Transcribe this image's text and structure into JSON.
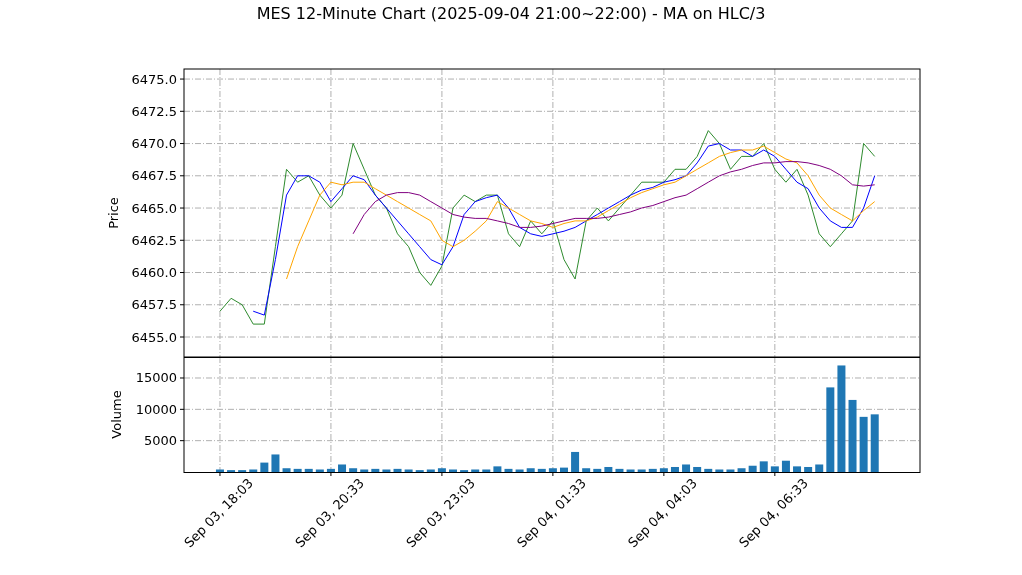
{
  "title": "MES 12-Minute Chart (2025-09-04 21:00~22:00) - MA on HLC/3",
  "price_panel": {
    "chart_data": {
      "type": "line",
      "ylabel": "Price",
      "grid": true,
      "ylim": [
        6453.45,
        6475.78
      ],
      "yticks": [
        {
          "value": 6455,
          "label": "6455.0"
        },
        {
          "value": 6457.5,
          "label": "6457.5"
        },
        {
          "value": 6460,
          "label": "6460.0"
        },
        {
          "value": 6462.5,
          "label": "6462.5"
        },
        {
          "value": 6465,
          "label": "6465.0"
        },
        {
          "value": 6467.5,
          "label": "6467.5"
        },
        {
          "value": 6470,
          "label": "6470.0"
        },
        {
          "value": 6472.5,
          "label": "6472.5"
        },
        {
          "value": 6475,
          "label": "6475.0"
        }
      ],
      "series": [
        {
          "color": "#2e8b2e",
          "values": [
            6457,
            6458,
            6457.5,
            6456,
            6456,
            6462,
            6468,
            6467,
            6467.5,
            6466,
            6465,
            6466,
            6470,
            6468,
            6466,
            6465,
            6463,
            6462,
            6460,
            6459,
            6460.5,
            6465,
            6466,
            6465.5,
            6466,
            6466,
            6463,
            6462,
            6464,
            6463,
            6464,
            6461,
            6459.5,
            6464,
            6465,
            6464,
            6465,
            6466,
            6467,
            6467,
            6467,
            6468,
            6468,
            6469,
            6471,
            6470,
            6468,
            6469,
            6469,
            6470,
            6468,
            6467,
            6468,
            6466,
            6463,
            6462,
            6463,
            6464,
            6470,
            6469
          ]
        },
        {
          "color": "#0000ff",
          "values": [
            null,
            null,
            null,
            6457,
            6456.7,
            6461,
            6466,
            6467.5,
            6467.5,
            6467,
            6465.5,
            6466.5,
            6467.5,
            6467.2,
            6466,
            6465,
            6464,
            6463,
            6462,
            6461,
            6460.6,
            6462,
            6464.5,
            6465.5,
            6465.8,
            6466,
            6465,
            6463.5,
            6463,
            6462.8,
            6463,
            6463.2,
            6463.5,
            6464,
            6464.5,
            6465,
            6465.5,
            6466,
            6466.4,
            6466.6,
            6467,
            6467.2,
            6467.5,
            6468.5,
            6469.8,
            6470,
            6469.5,
            6469.5,
            6469,
            6469.5,
            6469,
            6468,
            6467,
            6466.5,
            6465,
            6464,
            6463.5,
            6463.5,
            6465,
            6467.5
          ]
        },
        {
          "color": "#ffa500",
          "values": [
            null,
            null,
            null,
            null,
            null,
            null,
            6459.5,
            6462,
            6464,
            6466,
            6467,
            6466.8,
            6467,
            6467,
            6466.5,
            6466,
            6465.5,
            6465,
            6464.5,
            6464,
            6462.5,
            6462,
            6462.5,
            6463.2,
            6464,
            6465.5,
            6465,
            6464.5,
            6464,
            6463.8,
            6463.5,
            6463.8,
            6464,
            6464,
            6464.3,
            6464.8,
            6465.3,
            6465.8,
            6466.2,
            6466.5,
            6466.8,
            6467,
            6467.5,
            6468,
            6468.5,
            6469,
            6469.3,
            6469.5,
            6469.5,
            6469.8,
            6469.3,
            6468.8,
            6468.5,
            6467.5,
            6466,
            6465,
            6464.5,
            6464,
            6464.8,
            6465.5
          ]
        },
        {
          "color": "#800080",
          "values": [
            null,
            null,
            null,
            null,
            null,
            null,
            null,
            null,
            null,
            null,
            null,
            null,
            6463,
            6464.5,
            6465.5,
            6466,
            6466.2,
            6466.2,
            6466,
            6465.5,
            6465,
            6464.5,
            6464.3,
            6464.2,
            6464.2,
            6464,
            6463.8,
            6463.5,
            6463.5,
            6463.6,
            6463.8,
            6464,
            6464.2,
            6464.2,
            6464.2,
            6464.3,
            6464.5,
            6464.7,
            6465,
            6465.2,
            6465.5,
            6465.8,
            6466,
            6466.5,
            6467,
            6467.5,
            6467.8,
            6468,
            6468.3,
            6468.5,
            6468.5,
            6468.6,
            6468.6,
            6468.5,
            6468.3,
            6468,
            6467.5,
            6466.8,
            6466.7,
            6466.8
          ]
        }
      ]
    }
  },
  "volume_panel": {
    "chart_data": {
      "type": "bar",
      "ylabel": "Volume",
      "categories": [
        "Sep 03, 18:03",
        null,
        null,
        null,
        null,
        null,
        null,
        null,
        null,
        null,
        "Sep 03, 20:33",
        null,
        null,
        null,
        null,
        null,
        null,
        null,
        null,
        null,
        "Sep 03, 23:03",
        null,
        null,
        null,
        null,
        null,
        null,
        null,
        null,
        null,
        "Sep 04, 01:33",
        null,
        null,
        null,
        null,
        null,
        null,
        null,
        null,
        null,
        "Sep 04, 04:03",
        null,
        null,
        null,
        null,
        null,
        null,
        null,
        null,
        null,
        "Sep 04, 06:33",
        null,
        null,
        null,
        null,
        null,
        null,
        null,
        null,
        null
      ],
      "grid": true,
      "ylim": [
        0,
        18350
      ],
      "yticks": [
        {
          "value": 5000,
          "label": "5000"
        },
        {
          "value": 10000,
          "label": "10000"
        },
        {
          "value": 15000,
          "label": "15000"
        }
      ],
      "series": [
        {
          "color": "#1f77b4",
          "values": [
            400,
            300,
            300,
            400,
            1500,
            2800,
            600,
            500,
            500,
            400,
            500,
            1200,
            600,
            400,
            500,
            400,
            500,
            400,
            300,
            400,
            600,
            400,
            300,
            400,
            400,
            900,
            500,
            400,
            600,
            500,
            600,
            700,
            3200,
            600,
            500,
            800,
            500,
            400,
            400,
            500,
            600,
            800,
            1200,
            800,
            500,
            400,
            400,
            600,
            1000,
            1700,
            900,
            1800,
            900,
            800,
            1200,
            13500,
            17000,
            11500,
            8800,
            9200
          ]
        }
      ]
    }
  }
}
